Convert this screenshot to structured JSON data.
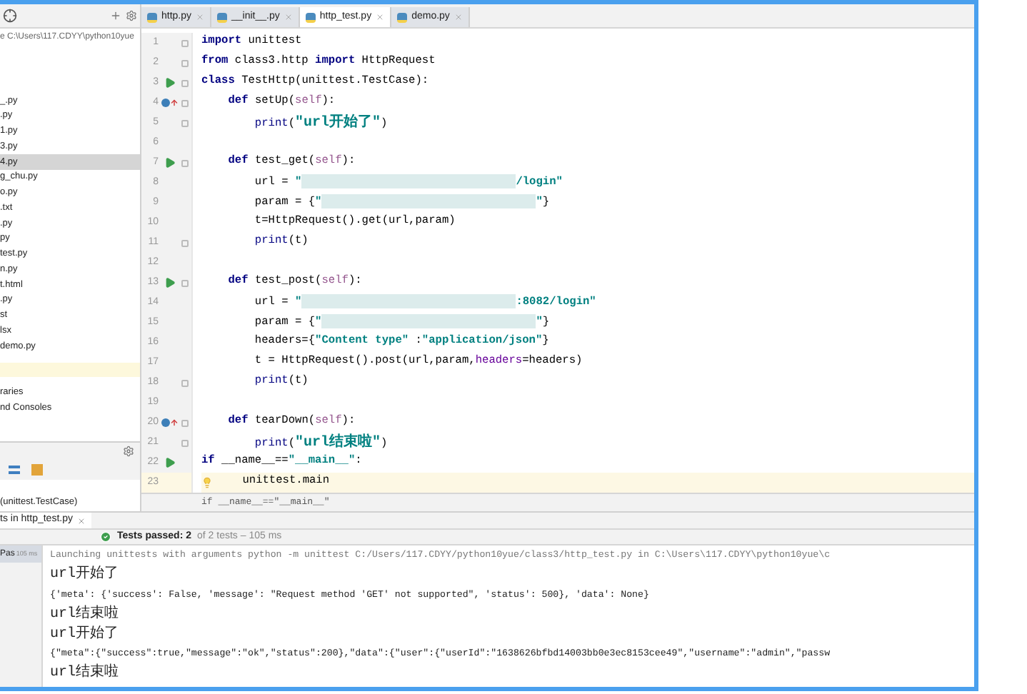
{
  "project_panel": {
    "path": "e C:\\Users\\117.CDYY\\python10yue",
    "items": [
      {
        "label": "_.py",
        "selected": false
      },
      {
        "label": ".py",
        "selected": false
      },
      {
        "label": "1.py",
        "selected": false
      },
      {
        "label": "3.py",
        "selected": false
      },
      {
        "label": "4.py",
        "selected": true
      },
      {
        "label": "g_chu.py",
        "selected": false
      },
      {
        "label": "o.py",
        "selected": false
      },
      {
        "label": ".txt",
        "selected": false
      },
      {
        "label": ".py",
        "selected": false
      },
      {
        "label": "py",
        "selected": false
      },
      {
        "label": "test.py",
        "selected": false
      },
      {
        "label": "n.py",
        "selected": false
      },
      {
        "label": "t.html",
        "selected": false
      },
      {
        "label": ".py",
        "selected": false
      },
      {
        "label": "st",
        "selected": false
      },
      {
        "label": "lsx",
        "selected": false
      },
      {
        "label": "demo.py",
        "selected": false
      }
    ],
    "extra_items": [
      {
        "label": "raries"
      },
      {
        "label": "nd Consoles"
      }
    ]
  },
  "structure_panel": {
    "item": "(unittest.TestCase)"
  },
  "editor": {
    "tabs": [
      {
        "label": "http.py",
        "selected": false
      },
      {
        "label": "__init__.py",
        "selected": false
      },
      {
        "label": "http_test.py",
        "selected": true
      },
      {
        "label": "demo.py",
        "selected": false
      }
    ],
    "lines": [
      {
        "number": "1",
        "kind": "plain",
        "fold": true,
        "current": false,
        "tokens": [
          {
            "kind": "keyword",
            "text": "import"
          },
          {
            "kind": "plain",
            "text": " unittest"
          }
        ]
      },
      {
        "number": "2",
        "kind": "plain",
        "fold": true,
        "current": false,
        "tokens": [
          {
            "kind": "keyword",
            "text": "from"
          },
          {
            "kind": "plain",
            "text": " class3.http "
          },
          {
            "kind": "keyword",
            "text": "import"
          },
          {
            "kind": "plain",
            "text": " HttpRequest"
          }
        ]
      },
      {
        "number": "3",
        "kind": "run",
        "fold": true,
        "current": false,
        "tokens": [
          {
            "kind": "keyword",
            "text": "class"
          },
          {
            "kind": "plain",
            "text": " TestHttp(unittest.TestCase):"
          }
        ]
      },
      {
        "number": "4",
        "kind": "override",
        "fold": true,
        "current": false,
        "tokens": [
          {
            "kind": "keyword",
            "text": "    def"
          },
          {
            "kind": "plain",
            "text": " setUp("
          },
          {
            "kind": "self",
            "text": "self"
          },
          {
            "kind": "plain",
            "text": "):"
          }
        ]
      },
      {
        "number": "5",
        "kind": "plain",
        "fold": true,
        "current": false,
        "tokens": [
          {
            "kind": "builtin",
            "text": "        print"
          },
          {
            "kind": "plain",
            "text": "("
          },
          {
            "kind": "string",
            "text": "\"url开始了\""
          },
          {
            "kind": "plain",
            "text": ")"
          }
        ]
      },
      {
        "number": "6",
        "kind": "plain",
        "fold": false,
        "current": false
      },
      {
        "number": "7",
        "kind": "run",
        "fold": true,
        "current": false,
        "tokens": [
          {
            "kind": "keyword",
            "text": "    def"
          },
          {
            "kind": "plain",
            "text": " test_get("
          },
          {
            "kind": "self",
            "text": "self"
          },
          {
            "kind": "plain",
            "text": "):"
          }
        ]
      },
      {
        "number": "8",
        "kind": "plain",
        "fold": false,
        "current": false,
        "tokens": [
          {
            "kind": "plain",
            "text": "        url = "
          },
          {
            "kind": "string",
            "text": "\""
          },
          {
            "kind": "redacted"
          },
          {
            "kind": "string",
            "text": "/login\""
          }
        ]
      },
      {
        "number": "9",
        "kind": "plain",
        "fold": false,
        "current": false,
        "tokens": [
          {
            "kind": "plain",
            "text": "        param = {"
          },
          {
            "kind": "string",
            "text": "\""
          },
          {
            "kind": "redacted"
          },
          {
            "kind": "string",
            "text": "\""
          },
          {
            "kind": "plain",
            "text": "}"
          }
        ]
      },
      {
        "number": "10",
        "kind": "plain",
        "fold": false,
        "current": false,
        "tokens": [
          {
            "kind": "plain",
            "text": "        t=HttpRequest().get(url,param)"
          }
        ]
      },
      {
        "number": "11",
        "kind": "plain",
        "fold": true,
        "current": false,
        "tokens": [
          {
            "kind": "builtin",
            "text": "        print"
          },
          {
            "kind": "plain",
            "text": "(t)"
          }
        ]
      },
      {
        "number": "12",
        "kind": "plain",
        "fold": false,
        "current": false
      },
      {
        "number": "13",
        "kind": "run",
        "fold": true,
        "current": false,
        "tokens": [
          {
            "kind": "keyword",
            "text": "    def"
          },
          {
            "kind": "plain",
            "text": " test_post("
          },
          {
            "kind": "self",
            "text": "self"
          },
          {
            "kind": "plain",
            "text": "):"
          }
        ]
      },
      {
        "number": "14",
        "kind": "plain",
        "fold": false,
        "current": false,
        "tokens": [
          {
            "kind": "plain",
            "text": "        url = "
          },
          {
            "kind": "string",
            "text": "\""
          },
          {
            "kind": "redacted"
          },
          {
            "kind": "string",
            "text": ":8082/login\""
          }
        ]
      },
      {
        "number": "15",
        "kind": "plain",
        "fold": false,
        "current": false,
        "tokens": [
          {
            "kind": "plain",
            "text": "        param = {"
          },
          {
            "kind": "string",
            "text": "\""
          },
          {
            "kind": "redacted"
          },
          {
            "kind": "string",
            "text": "\""
          },
          {
            "kind": "plain",
            "text": "}"
          }
        ]
      },
      {
        "number": "16",
        "kind": "plain",
        "fold": false,
        "current": false,
        "tokens": [
          {
            "kind": "plain",
            "text": "        headers={"
          },
          {
            "kind": "string",
            "text": "\"Content type\""
          },
          {
            "kind": "plain",
            "text": " :"
          },
          {
            "kind": "string",
            "text": "\"application/json\""
          },
          {
            "kind": "plain",
            "text": "}"
          }
        ]
      },
      {
        "number": "17",
        "kind": "plain",
        "fold": false,
        "current": false,
        "tokens": [
          {
            "kind": "plain",
            "text": "        t = HttpRequest().post(url,param,"
          },
          {
            "kind": "param",
            "text": "headers"
          },
          {
            "kind": "plain",
            "text": "=headers)"
          }
        ]
      },
      {
        "number": "18",
        "kind": "plain",
        "fold": true,
        "current": false,
        "tokens": [
          {
            "kind": "builtin",
            "text": "        print"
          },
          {
            "kind": "plain",
            "text": "(t)"
          }
        ]
      },
      {
        "number": "19",
        "kind": "plain",
        "fold": false,
        "current": false
      },
      {
        "number": "20",
        "kind": "override",
        "fold": true,
        "current": false,
        "tokens": [
          {
            "kind": "keyword",
            "text": "    def"
          },
          {
            "kind": "plain",
            "text": " tearDown("
          },
          {
            "kind": "self",
            "text": "self"
          },
          {
            "kind": "plain",
            "text": "):"
          }
        ]
      },
      {
        "number": "21",
        "kind": "plain",
        "fold": true,
        "current": false,
        "tokens": [
          {
            "kind": "builtin",
            "text": "        print"
          },
          {
            "kind": "plain",
            "text": "("
          },
          {
            "kind": "string",
            "text": "\"url结束啦\""
          },
          {
            "kind": "plain",
            "text": ")"
          }
        ]
      },
      {
        "number": "22",
        "kind": "run",
        "fold": false,
        "current": false,
        "tokens": [
          {
            "kind": "keyword",
            "text": "if"
          },
          {
            "kind": "plain",
            "text": " __name__=="
          },
          {
            "kind": "string",
            "text": "\"__main__\""
          },
          {
            "kind": "plain",
            "text": ":"
          }
        ]
      },
      {
        "number": "23",
        "kind": "bulb",
        "fold": false,
        "current": true,
        "tokens": [
          {
            "kind": "plain",
            "text": "    unittest.main"
          }
        ]
      }
    ],
    "breadcrumb": "if __name__==\"__main__\""
  },
  "run_panel": {
    "tab": "ts in http_test.py",
    "status": "Tests passed: 2",
    "summary": "of 2 tests – 105 ms",
    "tests": [
      {
        "label": "Pas",
        "time": "105 ms"
      }
    ],
    "console": [
      {
        "kind": "command",
        "text": "Launching unittests with arguments python -m unittest C:/Users/117.CDYY/python10yue/class3/http_test.py in C:\\Users\\117.CDYY\\python10yue\\c"
      },
      {
        "kind": "output",
        "text": "url开始了"
      },
      {
        "kind": "output",
        "text": "{'meta': {'success': False, 'message': \"Request method 'GET' not supported\", 'status': 500}, 'data': None}"
      },
      {
        "kind": "output",
        "text": "url结束啦"
      },
      {
        "kind": "output",
        "text": "url开始了"
      },
      {
        "kind": "output",
        "text": "{\"meta\":{\"success\":true,\"message\":\"ok\",\"status\":200},\"data\":{\"user\":{\"userId\":\"1638626bfbd14003bb0e3ec8153cee49\",\"username\":\"admin\",\"passw"
      },
      {
        "kind": "output",
        "text": "url结束啦"
      }
    ]
  }
}
